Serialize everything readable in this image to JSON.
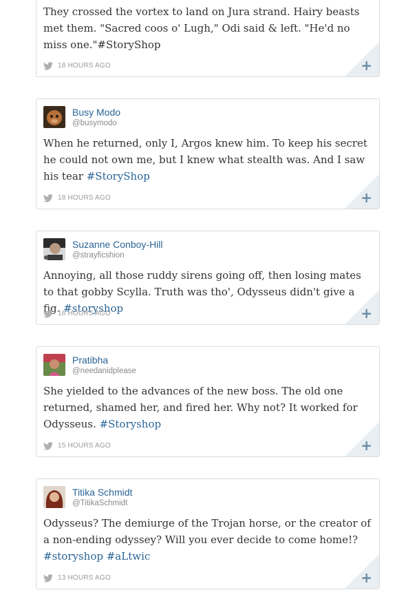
{
  "tweets": [
    {
      "text_parts": [
        "They crossed the vortex to land on Jura strand. Hairy beasts met them. \"Sacred coos o' Lugh,\" Odi said & left. \"He'd no miss one.\"#StoryShop"
      ],
      "time": "18 HOURS AGO"
    },
    {
      "name": "Busy Modo",
      "handle": "@busymodo",
      "text": "When he returned, only I, Argos knew him. To keep his secret he could not own me, but I knew what stealth was. And I saw his tear",
      "hashtags": "#StoryShop",
      "time": "18 HOURS AGO"
    },
    {
      "name": "Suzanne Conboy-Hill",
      "handle": "@strayficshion",
      "text": "Annoying, all those ruddy sirens going off, then losing mates to that gobby Scylla. Truth was tho', Odysseus didn't give a fig.",
      "hashtags": "#storyshop",
      "time": "16 HOURS AGO"
    },
    {
      "name": "Pratibha",
      "handle": "@needanidplease",
      "text": "She yielded to the advances of the new boss. The old one returned, shamed her, and fired her. Why not? It worked for Odysseus.",
      "hashtags": "#Storyshop",
      "time": "15 HOURS AGO"
    },
    {
      "name": "Titika Schmidt",
      "handle": "@TitikaSchmidt",
      "text": "Odysseus? The demiurge of the Trojan horse, or the creator of a non-ending odyssey? Will you ever decide to come home!?",
      "hashtags": "#storyshop #aLtwic",
      "time": "13 HOURS AGO"
    }
  ],
  "icons": {
    "source": "twitter-bird-icon",
    "action": "plus-icon"
  },
  "colors": {
    "link": "#2a6496",
    "border": "#dcdcdc",
    "corner": "#e8eef2",
    "meta": "#9a9a9a"
  }
}
